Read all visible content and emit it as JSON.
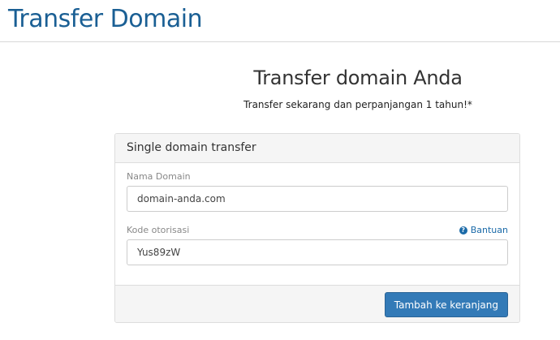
{
  "header": {
    "title": "Transfer Domain"
  },
  "hero": {
    "title": "Transfer domain Anda",
    "subtitle": "Transfer sekarang dan perpanjangan 1 tahun!*"
  },
  "panel": {
    "heading": "Single domain transfer",
    "domain_field": {
      "label": "Nama Domain",
      "value": "domain-anda.com"
    },
    "auth_field": {
      "label": "Kode otorisasi",
      "value": "Yus89zW"
    },
    "help": {
      "label": "Bantuan",
      "icon": "question-circle-icon"
    },
    "submit_label": "Tambah ke keranjang"
  },
  "colors": {
    "title": "#1a5f94",
    "primary_button": "#337ab7",
    "link": "#1a6aa8"
  }
}
